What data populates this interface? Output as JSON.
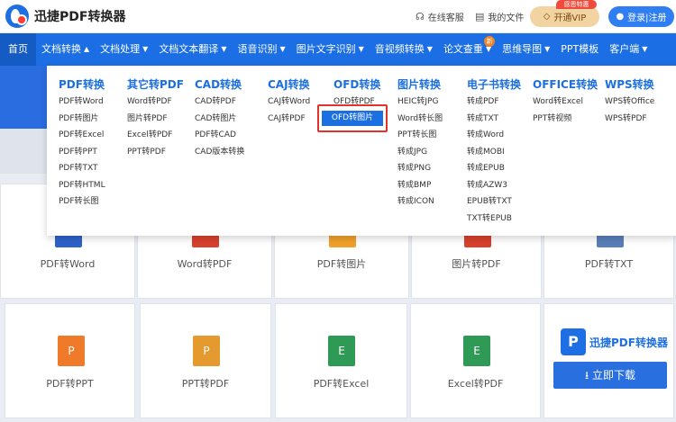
{
  "header": {
    "brand": "迅捷PDF转换器",
    "service": "在线客服",
    "files": "我的文件",
    "vip": "开通VIP",
    "vip_badge": "感恩特惠",
    "login": "登录|注册"
  },
  "nav": {
    "items": [
      {
        "label": "首页"
      },
      {
        "label": "文档转换",
        "caret": "▲"
      },
      {
        "label": "文档处理",
        "caret": "▼"
      },
      {
        "label": "文档文本翻译",
        "caret": "▼"
      },
      {
        "label": "语音识别",
        "caret": "▼"
      },
      {
        "label": "图片文字识别",
        "caret": "▼"
      },
      {
        "label": "音视频转换",
        "caret": "▼"
      },
      {
        "label": "论文查重",
        "caret": "▼",
        "badge": "新"
      },
      {
        "label": "思维导图",
        "caret": "▼"
      },
      {
        "label": "PPT模板"
      },
      {
        "label": "客户端",
        "caret": "▼"
      }
    ]
  },
  "dropdown": {
    "columns": [
      {
        "head": "PDF转换",
        "items": [
          "PDF转Word",
          "PDF转图片",
          "PDF转Excel",
          "PDF转PPT",
          "PDF转TXT",
          "PDF转HTML",
          "PDF转长图"
        ]
      },
      {
        "head": "其它转PDF",
        "items": [
          "Word转PDF",
          "图片转PDF",
          "Excel转PDF",
          "PPT转PDF"
        ]
      },
      {
        "head": "CAD转换",
        "items": [
          "CAD转PDF",
          "CAD转图片",
          "PDF转CAD",
          "CAD版本转换"
        ]
      },
      {
        "head": "CAJ转换",
        "items": [
          "CAJ转Word",
          "CAJ转PDF"
        ]
      },
      {
        "head": "OFD转换",
        "items": [
          "OFD转PDF",
          "OFD转图片"
        ]
      },
      {
        "head": "图片转换",
        "items": [
          "HEIC转JPG",
          "Word转长图",
          "PPT转长图",
          "转成JPG",
          "转成PNG",
          "转成BMP",
          "转成ICON"
        ]
      },
      {
        "head": "电子书转换",
        "items": [
          "转成PDF",
          "转成TXT",
          "转成Word",
          "转成MOBI",
          "转成EPUB",
          "转成AZW3",
          "EPUB转TXT",
          "TXT转EPUB"
        ]
      },
      {
        "head": "OFFICE转换",
        "items": [
          "Word转Excel",
          "PPT转视频"
        ]
      },
      {
        "head": "WPS转换",
        "items": [
          "WPS转Office",
          "WPS转PDF"
        ]
      }
    ]
  },
  "cards_row1": [
    "PDF转Word",
    "Word转PDF",
    "PDF转图片",
    "图片转PDF",
    "PDF转TXT"
  ],
  "cards_row2": [
    {
      "label": "PDF转PPT",
      "icon": "P"
    },
    {
      "label": "PPT转PDF",
      "icon": "P"
    },
    {
      "label": "PDF转Excel",
      "icon": "E"
    },
    {
      "label": "Excel转PDF",
      "icon": "E"
    }
  ],
  "ad": {
    "logo": "P",
    "title": "迅捷PDF转换器",
    "download": "立即下载",
    "download_icon": "download-icon"
  },
  "colors": {
    "brand_blue": "#1b6ee3",
    "accent_red": "#e4322a",
    "vip_gold": "#f2d3a2"
  }
}
